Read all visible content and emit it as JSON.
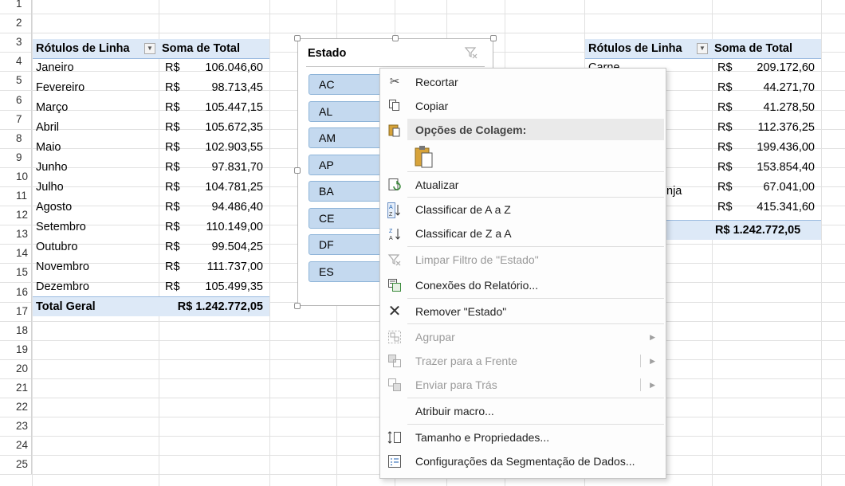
{
  "sheet": {
    "row_numbers": [
      "1",
      "2",
      "3",
      "4",
      "5",
      "6",
      "7",
      "8",
      "9",
      "10",
      "11",
      "12",
      "13",
      "14",
      "15",
      "16",
      "17",
      "18",
      "19",
      "20",
      "21",
      "22",
      "23",
      "24",
      "25"
    ]
  },
  "pivot_left": {
    "header_label": "Rótulos de Linha",
    "header_value": "Soma de Total",
    "rows": [
      {
        "label": "Janeiro",
        "cur": "R$",
        "value": "106.046,60"
      },
      {
        "label": "Fevereiro",
        "cur": "R$",
        "value": "98.713,45"
      },
      {
        "label": "Março",
        "cur": "R$",
        "value": "105.447,15"
      },
      {
        "label": "Abril",
        "cur": "R$",
        "value": "105.672,35"
      },
      {
        "label": "Maio",
        "cur": "R$",
        "value": "102.903,55"
      },
      {
        "label": "Junho",
        "cur": "R$",
        "value": "97.831,70"
      },
      {
        "label": "Julho",
        "cur": "R$",
        "value": "104.781,25"
      },
      {
        "label": "Agosto",
        "cur": "R$",
        "value": "94.486,40"
      },
      {
        "label": "Setembro",
        "cur": "R$",
        "value": "110.149,00"
      },
      {
        "label": "Outubro",
        "cur": "R$",
        "value": "99.504,25"
      },
      {
        "label": "Novembro",
        "cur": "R$",
        "value": "111.737,00"
      },
      {
        "label": "Dezembro",
        "cur": "R$",
        "value": "105.499,35"
      }
    ],
    "total_label": "Total Geral",
    "total_value": "R$ 1.242.772,05"
  },
  "pivot_right": {
    "header_label": "Rótulos de Linha",
    "header_value": "Soma de Total",
    "partial_labels": [
      "Carne",
      "nja"
    ],
    "rows": [
      {
        "cur": "R$",
        "value": "209.172,60"
      },
      {
        "cur": "R$",
        "value": "44.271,70"
      },
      {
        "cur": "R$",
        "value": "41.278,50"
      },
      {
        "cur": "R$",
        "value": "112.376,25"
      },
      {
        "cur": "R$",
        "value": "199.436,00"
      },
      {
        "cur": "R$",
        "value": "153.854,40"
      },
      {
        "cur": "R$",
        "value": "67.041,00"
      },
      {
        "cur": "R$",
        "value": "415.341,60"
      }
    ],
    "total_value": "R$ 1.242.772,05"
  },
  "slicer": {
    "title": "Estado",
    "items": [
      "AC",
      "AL",
      "AM",
      "AP",
      "BA",
      "CE",
      "DF",
      "ES"
    ]
  },
  "context_menu": {
    "items": [
      {
        "label": "Recortar",
        "icon": "scissors-icon"
      },
      {
        "label": "Copiar",
        "icon": "copy-icon"
      },
      {
        "label": "Opções de Colagem:",
        "icon": "paste-icon"
      },
      {
        "label": "Atualizar",
        "icon": "refresh-icon"
      },
      {
        "label": "Classificar de A a Z",
        "icon": "sort-az-icon"
      },
      {
        "label": "Classificar de Z a A",
        "icon": "sort-za-icon"
      },
      {
        "label": "Limpar Filtro de \"Estado\"",
        "icon": "clear-filter-icon",
        "disabled": true
      },
      {
        "label": "Conexões do Relatório...",
        "icon": "report-connections-icon"
      },
      {
        "label": "Remover \"Estado\"",
        "icon": "remove-icon"
      },
      {
        "label": "Agrupar",
        "icon": "group-icon",
        "disabled": true
      },
      {
        "label": "Trazer para a Frente",
        "icon": "bring-forward-icon",
        "disabled": true
      },
      {
        "label": "Enviar para Trás",
        "icon": "send-backward-icon",
        "disabled": true
      },
      {
        "label": "Atribuir macro...",
        "icon": ""
      },
      {
        "label": "Tamanho e Propriedades...",
        "icon": "size-properties-icon"
      },
      {
        "label": "Configurações da Segmentação de Dados...",
        "icon": "slicer-settings-icon"
      }
    ]
  },
  "colors": {
    "header_band": "#dde9f7",
    "slicer_button": "#c4d9ef",
    "menu_bg": "#fdfdfd"
  }
}
